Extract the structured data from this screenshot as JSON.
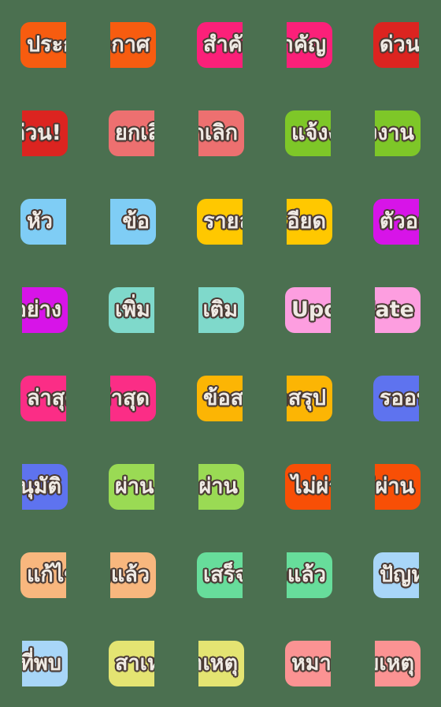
{
  "background_color": "#4b7050",
  "grid": {
    "columns": 5,
    "rows": 8,
    "tile_count": 40,
    "cell_size_px": 112,
    "tile_size_px": 58,
    "corner_radius_px": 12
  },
  "text_style": {
    "fill_color": "#efeae4",
    "outline_color": "#4a3a34"
  },
  "tiles": [
    {
      "id": 1,
      "row": 1,
      "col": 1,
      "color": "#f75c10",
      "text": "ประกาศ",
      "piece": "half-left",
      "phrase": "ประกาศ"
    },
    {
      "id": 2,
      "row": 1,
      "col": 2,
      "color": "#f75c10",
      "text": "ประกาศ",
      "piece": "half-right",
      "phrase": "ประกาศ"
    },
    {
      "id": 3,
      "row": 1,
      "col": 3,
      "color": "#fb2079",
      "text": "สำคัญ",
      "piece": "half-left",
      "phrase": "สำคัญ"
    },
    {
      "id": 4,
      "row": 1,
      "col": 4,
      "color": "#fb2079",
      "text": "สำคัญ",
      "piece": "half-right",
      "phrase": "สำคัญ"
    },
    {
      "id": 5,
      "row": 1,
      "col": 5,
      "color": "#dc2420",
      "text": "ด่วน!",
      "piece": "half-left",
      "phrase": "ด่วน!"
    },
    {
      "id": 6,
      "row": 2,
      "col": 1,
      "color": "#dc2420",
      "text": "ด่วน!",
      "piece": "half-right",
      "phrase": "ด่วน!"
    },
    {
      "id": 7,
      "row": 2,
      "col": 2,
      "color": "#ed7070",
      "text": "ยกเลิก",
      "piece": "half-left",
      "phrase": "ยกเลิก"
    },
    {
      "id": 8,
      "row": 2,
      "col": 3,
      "color": "#ed7070",
      "text": "ยกเลิก",
      "piece": "half-right",
      "phrase": "ยกเลิก"
    },
    {
      "id": 9,
      "row": 2,
      "col": 4,
      "color": "#7ec728",
      "text": "แจ้งงาน",
      "piece": "half-left",
      "phrase": "แจ้งงาน"
    },
    {
      "id": 10,
      "row": 2,
      "col": 5,
      "color": "#7ec728",
      "text": "แจ้งงาน",
      "piece": "half-right",
      "phrase": "แจ้งงาน"
    },
    {
      "id": 11,
      "row": 3,
      "col": 1,
      "color": "#7fcdf5",
      "text": "หัว",
      "piece": "half-left",
      "phrase": "หัวข้อ"
    },
    {
      "id": 12,
      "row": 3,
      "col": 2,
      "color": "#7fcdf5",
      "text": "ข้อ",
      "piece": "half-right",
      "phrase": "หัวข้อ"
    },
    {
      "id": 13,
      "row": 3,
      "col": 3,
      "color": "#ffc800",
      "text": "รายละเอียด",
      "piece": "half-left",
      "phrase": "รายละเอียด"
    },
    {
      "id": 14,
      "row": 3,
      "col": 4,
      "color": "#ffc800",
      "text": "รายละเอียด",
      "piece": "half-right",
      "phrase": "รายละเอียด"
    },
    {
      "id": 15,
      "row": 3,
      "col": 5,
      "color": "#d714e8",
      "text": "ตัวอย่าง",
      "piece": "half-left",
      "phrase": "ตัวอย่าง"
    },
    {
      "id": 16,
      "row": 4,
      "col": 1,
      "color": "#d714e8",
      "text": "ตัวอย่าง",
      "piece": "half-right",
      "phrase": "ตัวอย่าง"
    },
    {
      "id": 17,
      "row": 4,
      "col": 2,
      "color": "#7fd9cb",
      "text": "เพิ่ม",
      "piece": "half-left",
      "phrase": "เพิ่มเติม"
    },
    {
      "id": 18,
      "row": 4,
      "col": 3,
      "color": "#7fd9cb",
      "text": "เติม",
      "piece": "half-right",
      "phrase": "เพิ่มเติม"
    },
    {
      "id": 19,
      "row": 4,
      "col": 4,
      "color": "#fd9ee0",
      "text": "Update",
      "piece": "half-left",
      "phrase": "Update"
    },
    {
      "id": 20,
      "row": 4,
      "col": 5,
      "color": "#fd9ee0",
      "text": "Update",
      "piece": "half-right",
      "phrase": "Update"
    },
    {
      "id": 21,
      "row": 5,
      "col": 1,
      "color": "#fb2d86",
      "text": "ล่าสุด",
      "piece": "half-left",
      "phrase": "ล่าสุด"
    },
    {
      "id": 22,
      "row": 5,
      "col": 2,
      "color": "#fb2d86",
      "text": "ล่าสุด",
      "piece": "half-right",
      "phrase": "ล่าสุด"
    },
    {
      "id": 23,
      "row": 5,
      "col": 3,
      "color": "#fcb504",
      "text": "ข้อสรุป",
      "piece": "half-left",
      "phrase": "ข้อสรุป"
    },
    {
      "id": 24,
      "row": 5,
      "col": 4,
      "color": "#fcb504",
      "text": "ข้อสรุป",
      "piece": "half-right",
      "phrase": "ข้อสรุป"
    },
    {
      "id": 25,
      "row": 5,
      "col": 5,
      "color": "#5e73ef",
      "text": "รออนุมัติ",
      "piece": "half-left",
      "phrase": "รออนุมัติ"
    },
    {
      "id": 26,
      "row": 6,
      "col": 1,
      "color": "#5e73ef",
      "text": "รออนุมัติ",
      "piece": "half-right",
      "phrase": "รออนุมัติ"
    },
    {
      "id": 27,
      "row": 6,
      "col": 2,
      "color": "#9ada54",
      "text": "ผ่าน",
      "piece": "half-left",
      "phrase": "ผ่าน"
    },
    {
      "id": 28,
      "row": 6,
      "col": 3,
      "color": "#9ada54",
      "text": "ผ่าน",
      "piece": "half-right",
      "phrase": "ผ่าน"
    },
    {
      "id": 29,
      "row": 6,
      "col": 4,
      "color": "#f84f06",
      "text": "ไม่ผ่าน",
      "piece": "half-left",
      "phrase": "ไม่ผ่าน"
    },
    {
      "id": 30,
      "row": 6,
      "col": 5,
      "color": "#f84f06",
      "text": "ไม่ผ่าน",
      "piece": "half-right",
      "phrase": "ไม่ผ่าน"
    },
    {
      "id": 31,
      "row": 7,
      "col": 1,
      "color": "#f8b77e",
      "text": "แก้ไขแล้ว",
      "piece": "half-left",
      "phrase": "แก้ไขแล้ว"
    },
    {
      "id": 32,
      "row": 7,
      "col": 2,
      "color": "#f8b77e",
      "text": "แก้ไขแล้ว",
      "piece": "half-right",
      "phrase": "แก้ไขแล้ว"
    },
    {
      "id": 33,
      "row": 7,
      "col": 3,
      "color": "#67dd9b",
      "text": "เสร็จแล้ว",
      "piece": "half-left",
      "phrase": "เสร็จแล้ว"
    },
    {
      "id": 34,
      "row": 7,
      "col": 4,
      "color": "#67dd9b",
      "text": "เสร็จแล้ว",
      "piece": "half-right",
      "phrase": "เสร็จแล้ว"
    },
    {
      "id": 35,
      "row": 7,
      "col": 5,
      "color": "#a8d6f8",
      "text": "ปัญหาที่พบ",
      "piece": "half-left",
      "phrase": "ปัญหาที่พบ"
    },
    {
      "id": 36,
      "row": 8,
      "col": 1,
      "color": "#a8d6f8",
      "text": "ปัญหาที่พบ",
      "piece": "half-right",
      "phrase": "ปัญหาที่พบ"
    },
    {
      "id": 37,
      "row": 8,
      "col": 2,
      "color": "#e4e472",
      "text": "สาเหตุ",
      "piece": "half-left",
      "phrase": "สาเหตุ"
    },
    {
      "id": 38,
      "row": 8,
      "col": 3,
      "color": "#e4e472",
      "text": "สาเหตุ",
      "piece": "half-right",
      "phrase": "สาเหตุ"
    },
    {
      "id": 39,
      "row": 8,
      "col": 4,
      "color": "#fb9393",
      "text": "หมายเหตุ",
      "piece": "half-left",
      "phrase": "หมายเหตุ"
    },
    {
      "id": 40,
      "row": 8,
      "col": 5,
      "color": "#fb9393",
      "text": "หมายเหตุ",
      "piece": "half-right",
      "phrase": "หมายเหตุ"
    }
  ]
}
